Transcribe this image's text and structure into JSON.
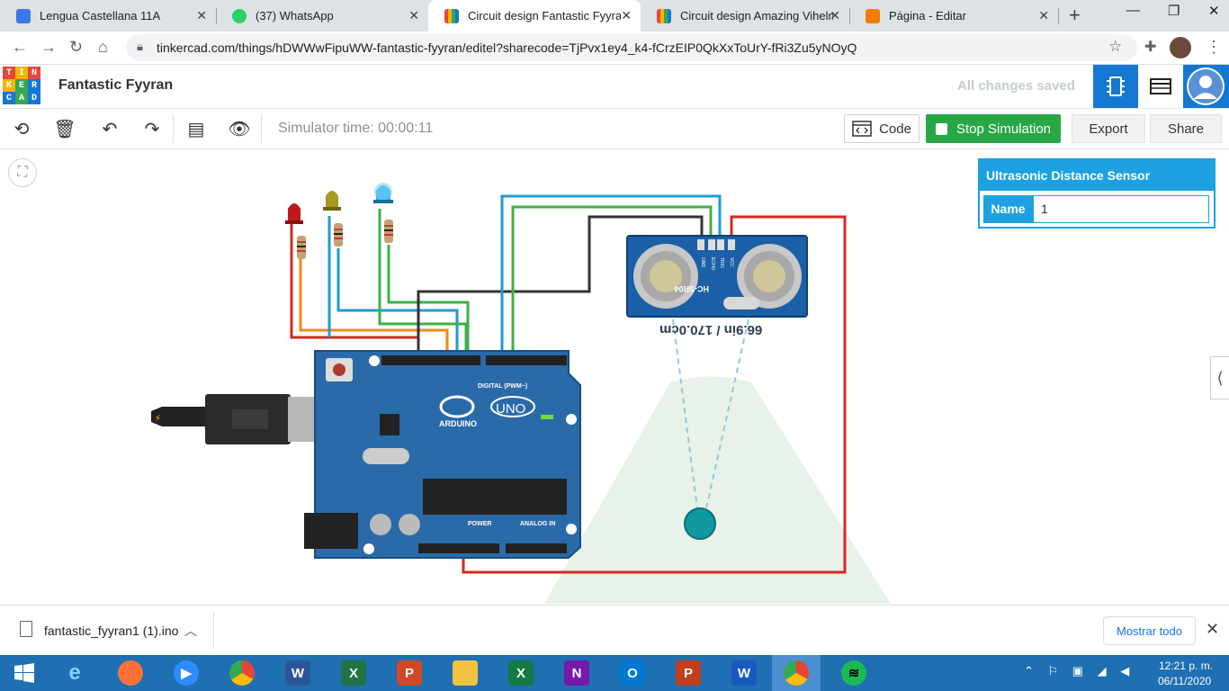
{
  "browser": {
    "tabs": [
      {
        "title": "Lengua Castellana 11A",
        "favicon_color": "#3b78e7"
      },
      {
        "title": "(37) WhatsApp",
        "favicon_color": "#25d366"
      },
      {
        "title": "Circuit design Fantastic Fyyran |",
        "favicon_color": "#e8a33b",
        "active": true
      },
      {
        "title": "Circuit design Amazing Vihelmo",
        "favicon_color": "#e8a33b"
      },
      {
        "title": "Página - Editar",
        "favicon_color": "#f57c00"
      }
    ],
    "url": "tinkercad.com/things/hDWWwFipuWW-fantastic-fyyran/editel?sharecode=TjPvx1ey4_k4-fCrzEIP0QkXxToUrY-fRi3Zu5yNOyQ"
  },
  "app": {
    "logo_letters": [
      "T",
      "I",
      "N",
      "K",
      "E",
      "R",
      "C",
      "A",
      "D"
    ],
    "design_title": "Fantastic Fyyran",
    "save_status": "All changes saved"
  },
  "toolbar": {
    "simulator_time": "Simulator time: 00:00:11",
    "code_label": "Code",
    "stop_label": "Stop Simulation",
    "export_label": "Export",
    "share_label": "Share"
  },
  "inspector": {
    "title": "Ultrasonic Distance Sensor",
    "name_label": "Name",
    "name_value": "1"
  },
  "circuit": {
    "distance_readout": "66.9in / 170.0cm",
    "sensor_model": "HC-SR04",
    "sensor_pins": [
      "GND",
      "ECHO",
      "TRIG",
      "VCC"
    ],
    "board_brand": "ARDUINO",
    "board_model": "UNO",
    "digital_header": "DIGITAL (PWM~)",
    "power_header": "POWER",
    "analog_header": "ANALOG IN",
    "led_colors": [
      "#c0181c",
      "#a89a1c",
      "#29a8e0"
    ]
  },
  "downloads": {
    "file_name": "fantastic_fyyran1 (1).ino",
    "show_all": "Mostrar todo"
  },
  "taskbar": {
    "time": "12:21 p. m.",
    "date": "06/11/2020"
  }
}
